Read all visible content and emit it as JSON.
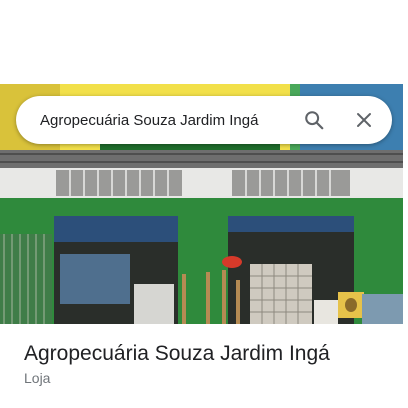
{
  "search": {
    "query": "Agropecuária Souza Jardim Ingá",
    "search_icon": "search-icon",
    "close_icon": "close-icon"
  },
  "photo": {
    "alt": "Agropecuária Souza Jardim Ingá"
  },
  "place": {
    "name": "Agropecuária Souza Jardim Ingá",
    "category": "Loja"
  },
  "colors": {
    "storefront_green": "#2f8a3c",
    "text_primary": "#202124",
    "text_secondary": "#70757a",
    "icon_gray": "#5f6368"
  }
}
